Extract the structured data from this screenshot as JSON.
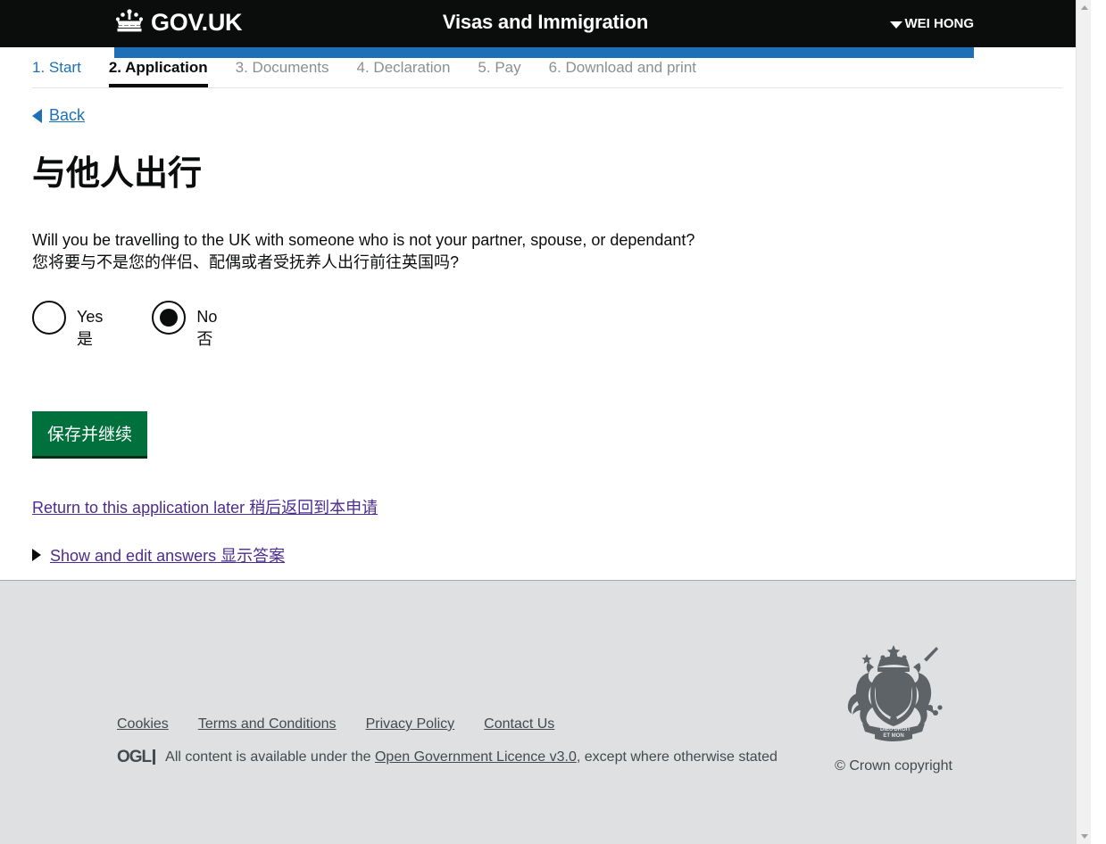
{
  "header": {
    "brand": "GOV.UK",
    "crown_icon": "crown-icon",
    "service_name": "Visas and Immigration",
    "account_name": "WEI HONG",
    "caret_icon": "chevron-down-icon",
    "accent_blue": "#1d70b8",
    "background": "#0b0c0c"
  },
  "tabs": [
    {
      "label": "1. Start",
      "state": "link"
    },
    {
      "label": "2. Application",
      "state": "active"
    },
    {
      "label": "3. Documents",
      "state": "done"
    },
    {
      "label": "4. Declaration",
      "state": "done"
    },
    {
      "label": "5. Pay",
      "state": "done"
    },
    {
      "label": "6. Download and print",
      "state": "done"
    }
  ],
  "back": {
    "label": "Back",
    "icon": "chevron-left-icon"
  },
  "main": {
    "title": "与他人出行",
    "question_en": "Will you be travelling to the UK with someone who is not your partner, spouse, or dependant?",
    "question_cn": "您将要与不是您的伴侣、配偶或者受抚养人出行前往英国吗?",
    "options": [
      {
        "label_en": "Yes",
        "label_cn": "是",
        "checked": false
      },
      {
        "label_en": "No",
        "label_cn": "否",
        "checked": true
      }
    ],
    "save_button": "保存并继续",
    "save_button_color": "#00703c",
    "return_link": "Return to this application later 稍后返回到本申请",
    "details_link": "Show and edit answers 显示答案",
    "details_icon": "triangle-right-icon",
    "link_visited_color": "#4c2c92"
  },
  "footer": {
    "links": [
      "Cookies",
      "Terms and Conditions",
      "Privacy Policy",
      "Contact Us"
    ],
    "ogl_logo": "OGL",
    "licence_prefix": "All content is available under the ",
    "licence_link": "Open Government Licence v3.0",
    "licence_suffix": ", except where otherwise stated",
    "crest_icon": "royal-coat-of-arms-icon",
    "copyright": "© Crown copyright",
    "background": "#dee0e2"
  },
  "scrollbar": {
    "up_icon": "scroll-up-arrow-icon",
    "down_icon": "scroll-down-arrow-icon"
  }
}
